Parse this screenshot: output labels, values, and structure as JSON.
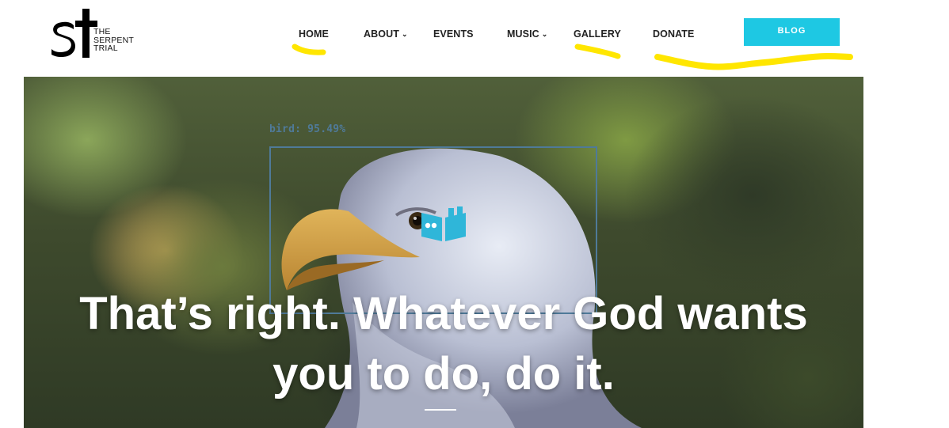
{
  "brand": {
    "logo_lines": [
      "THE",
      "SERPENT",
      "TRIAL"
    ]
  },
  "nav": {
    "items": [
      {
        "label": "HOME"
      },
      {
        "label": "ABOUT",
        "has_dropdown": true
      },
      {
        "label": "EVENTS"
      },
      {
        "label": "MUSIC",
        "has_dropdown": true
      },
      {
        "label": "GALLERY"
      },
      {
        "label": "DONATE"
      }
    ],
    "dropdown_glyph": "⌄",
    "cta_label": "BLOG"
  },
  "hero": {
    "detection_label": "bird: 95.49%",
    "headline_line1": "That’s right. Whatever God wants",
    "headline_line2": "you to do, do it."
  },
  "colors": {
    "accent": "#1ec8e3",
    "highlighter": "#ffe600",
    "detection_box": "#4f7a99"
  },
  "icons": {
    "logo": "st-monogram-logo",
    "dropdown": "chevron-down-icon",
    "quote": "quote-book-icon"
  }
}
